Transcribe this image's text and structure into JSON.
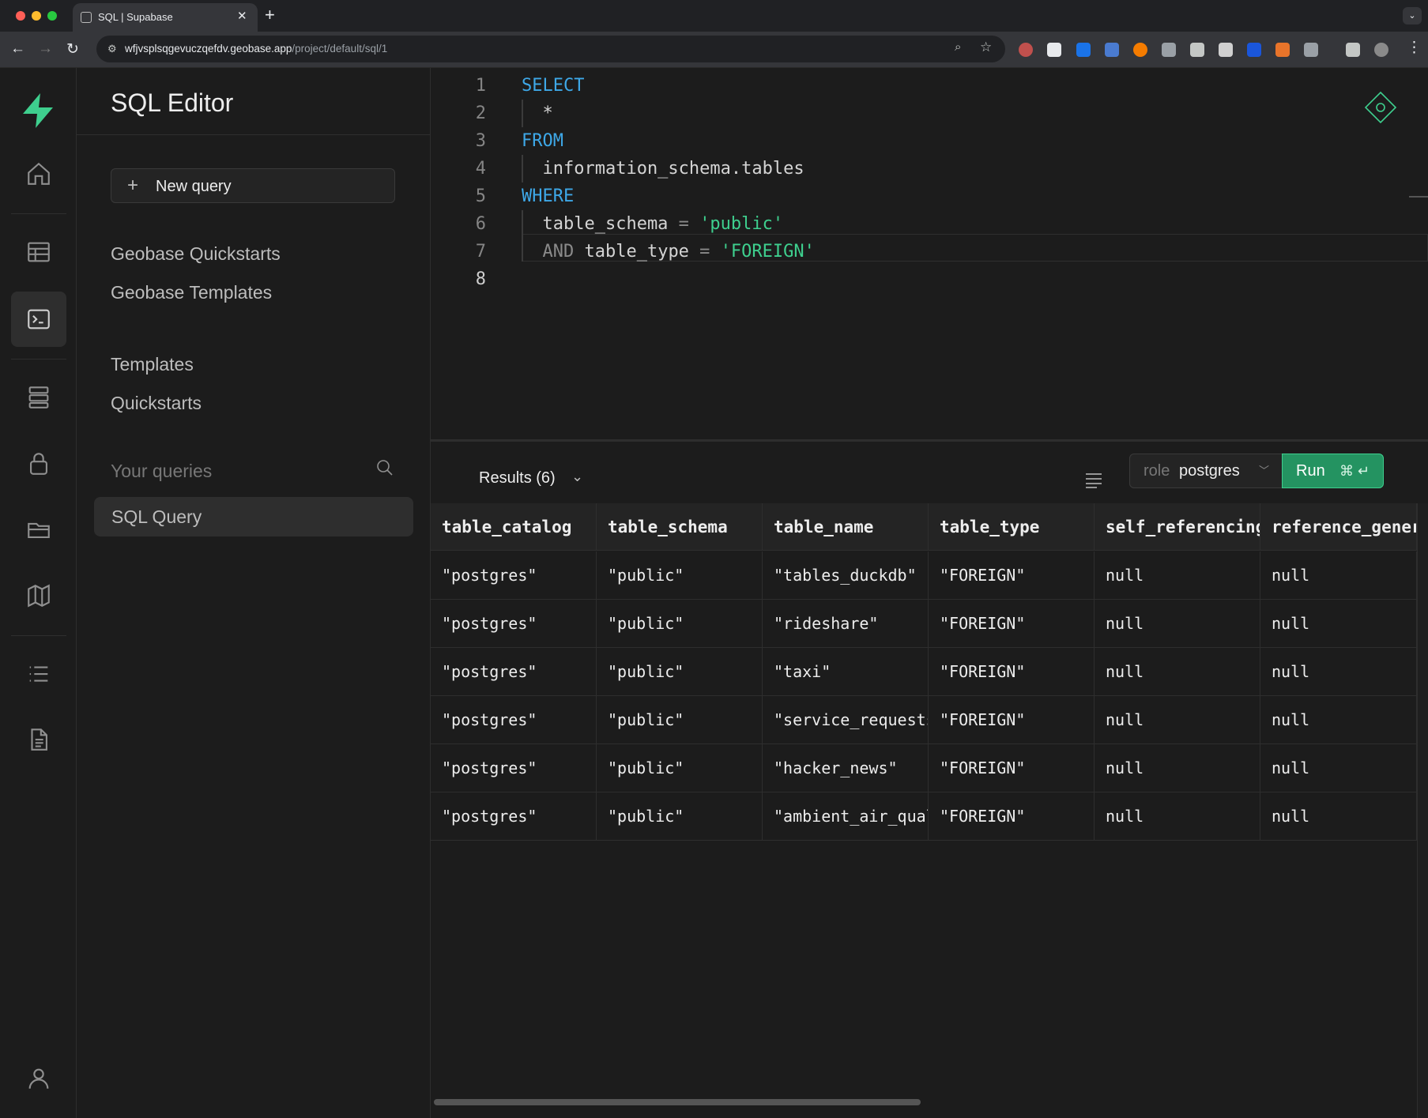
{
  "browser": {
    "tab_title": "SQL | Supabase",
    "url_host": "wfjvsplsqgevuczqefdv.geobase.app",
    "url_path": "/project/default/sql/1"
  },
  "sidebar": {
    "title": "SQL Editor",
    "new_query_label": "New query",
    "links": [
      "Geobase Quickstarts",
      "Geobase Templates",
      "Templates",
      "Quickstarts"
    ],
    "your_queries_label": "Your queries",
    "queries": [
      "SQL Query"
    ]
  },
  "editor": {
    "lines": [
      {
        "n": "1",
        "tokens": [
          {
            "t": "SELECT",
            "c": "kw"
          }
        ]
      },
      {
        "n": "2",
        "tokens": [
          {
            "t": "  *",
            "c": "id"
          }
        ]
      },
      {
        "n": "3",
        "tokens": [
          {
            "t": "FROM",
            "c": "kw"
          }
        ]
      },
      {
        "n": "4",
        "tokens": [
          {
            "t": "  information_schema.tables",
            "c": "id"
          }
        ]
      },
      {
        "n": "5",
        "tokens": [
          {
            "t": "WHERE",
            "c": "kw"
          }
        ]
      },
      {
        "n": "6",
        "tokens": [
          {
            "t": "  table_schema",
            "c": "id"
          },
          {
            "t": " = ",
            "c": "op"
          },
          {
            "t": "'public'",
            "c": "str"
          }
        ]
      },
      {
        "n": "7",
        "tokens": [
          {
            "t": "  AND",
            "c": "op"
          },
          {
            "t": " table_type",
            "c": "id"
          },
          {
            "t": " = ",
            "c": "op"
          },
          {
            "t": "'FOREIGN'",
            "c": "str"
          }
        ]
      },
      {
        "n": "8",
        "tokens": []
      }
    ]
  },
  "results": {
    "title": "Results (6)",
    "role_key": "role",
    "role_value": "postgres",
    "run_label": "Run",
    "run_shortcut": "⌘ ↵",
    "columns": [
      "table_catalog",
      "table_schema",
      "table_name",
      "table_type",
      "self_referencing_column_name",
      "reference_generation"
    ],
    "rows": [
      [
        "\"postgres\"",
        "\"public\"",
        "\"tables_duckdb\"",
        "\"FOREIGN\"",
        "null",
        "null"
      ],
      [
        "\"postgres\"",
        "\"public\"",
        "\"rideshare\"",
        "\"FOREIGN\"",
        "null",
        "null"
      ],
      [
        "\"postgres\"",
        "\"public\"",
        "\"taxi\"",
        "\"FOREIGN\"",
        "null",
        "null"
      ],
      [
        "\"postgres\"",
        "\"public\"",
        "\"service_requests\"",
        "\"FOREIGN\"",
        "null",
        "null"
      ],
      [
        "\"postgres\"",
        "\"public\"",
        "\"hacker_news\"",
        "\"FOREIGN\"",
        "null",
        "null"
      ],
      [
        "\"postgres\"",
        "\"public\"",
        "\"ambient_air_quality\"",
        "\"FOREIGN\"",
        "null",
        "null"
      ]
    ]
  },
  "icons": {
    "nav": [
      "home-icon",
      "table-editor-icon",
      "sql-editor-icon",
      "database-icon",
      "auth-icon",
      "storage-icon",
      "map-icon",
      "logs-icon",
      "docs-icon",
      "account-icon"
    ]
  },
  "colors": {
    "brand": "#3ecf8e",
    "keyword": "#3ea8e8",
    "run_button": "#249361"
  }
}
